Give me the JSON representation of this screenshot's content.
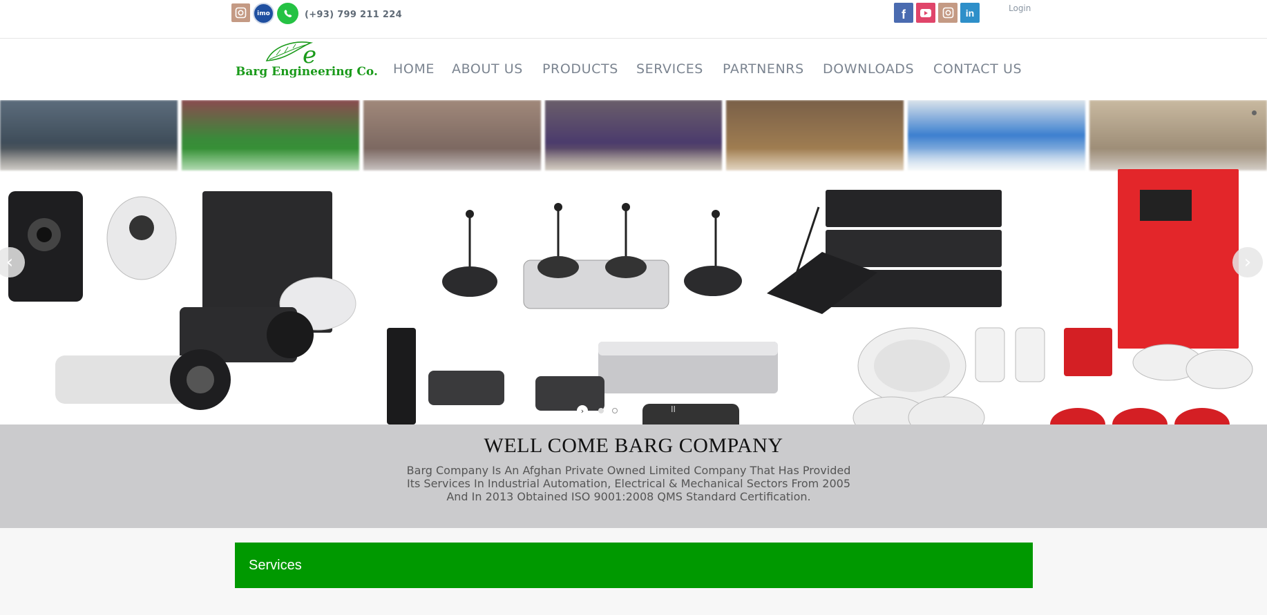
{
  "topbar": {
    "phone": "(+93) 799 211 224",
    "login": "Login",
    "left_icons": [
      "instagram-icon",
      "imo-icon",
      "whatsapp-icon"
    ],
    "right_icons": [
      "facebook-icon",
      "youtube-icon",
      "instagram-icon",
      "linkedin-icon"
    ],
    "imo_label": "imo",
    "linkedin_label": "in"
  },
  "logo": {
    "text": "Barg Engineering Co."
  },
  "nav": {
    "items": [
      "HOME",
      "ABOUT US",
      "PRODUCTS",
      "SERVICES",
      "PARTNENRS",
      "DOWNLOADS",
      "CONTACT US"
    ]
  },
  "slider": {
    "prev_icon": "chevron-left-icon",
    "next_icon": "chevron-right-icon",
    "pause_icon": "pause-icon",
    "dots": 3,
    "active_dot": 1
  },
  "welcome": {
    "title": "WELL COME BARG COMPANY",
    "line1": "Barg Company Is An Afghan Private Owned Limited Company That Has Provided",
    "line2": "Its Services In Industrial Automation, Electrical & Mechanical Sectors From 2005",
    "line3": "And In 2013 Obtained ISO 9001:2008 QMS Standard Certification."
  },
  "services": {
    "title": "Services"
  },
  "colors": {
    "brand_green": "#009900",
    "logo_green": "#1a9a1a",
    "nav_text": "#7b8490",
    "welcome_bg": "#cbcbcd"
  }
}
